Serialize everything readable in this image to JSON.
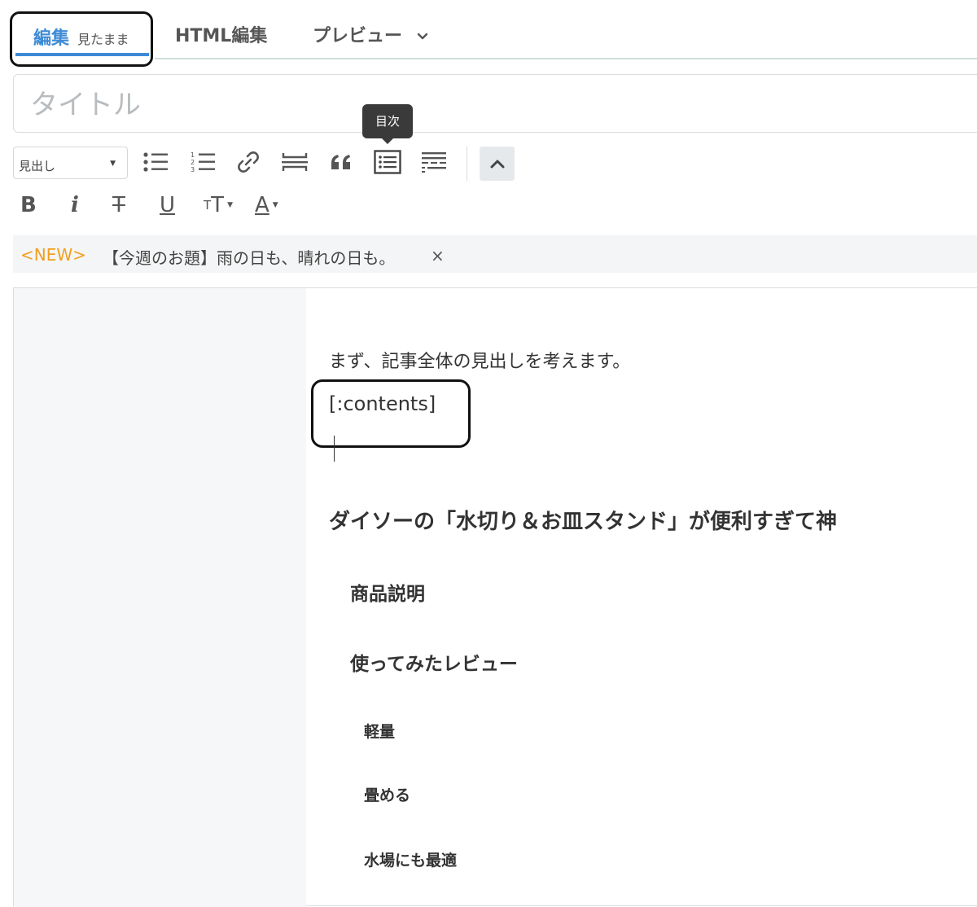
{
  "tabs": {
    "edit_label": "編集",
    "edit_sub": "見たまま",
    "html_label": "HTML編集",
    "preview_label": "プレビュー"
  },
  "title": {
    "placeholder": "タイトル"
  },
  "tooltip": {
    "text": "目次"
  },
  "toolbar": {
    "heading_select": "見出し",
    "icons": [
      "unordered-list-icon",
      "ordered-list-icon",
      "link-icon",
      "horizontal-rule-icon",
      "quote-icon",
      "table-of-contents-icon",
      "more-icon",
      "collapse-icon"
    ],
    "format_icons": [
      "bold",
      "italic",
      "strikethrough",
      "underline",
      "text-size",
      "text-color"
    ],
    "bold": "B",
    "italic": "i",
    "strike": "T",
    "underline": "U",
    "size": "TT",
    "color": "A"
  },
  "notice": {
    "new_tag": "<NEW>",
    "message": "【今週のお題】雨の日も、晴れの日も。",
    "close": "×"
  },
  "body": {
    "paragraph": "まず、記事全体の見出しを考えます。",
    "contents_tag": "[:contents]",
    "h2": "ダイソーの「水切り＆お皿スタンド」が便利すぎて神",
    "h3": [
      "商品説明",
      "使ってみたレビュー"
    ],
    "h4": [
      "軽量",
      "畳める",
      "水場にも最適"
    ]
  },
  "colors": {
    "accent": "#3d8bd6",
    "new_tag": "#f0a020"
  }
}
